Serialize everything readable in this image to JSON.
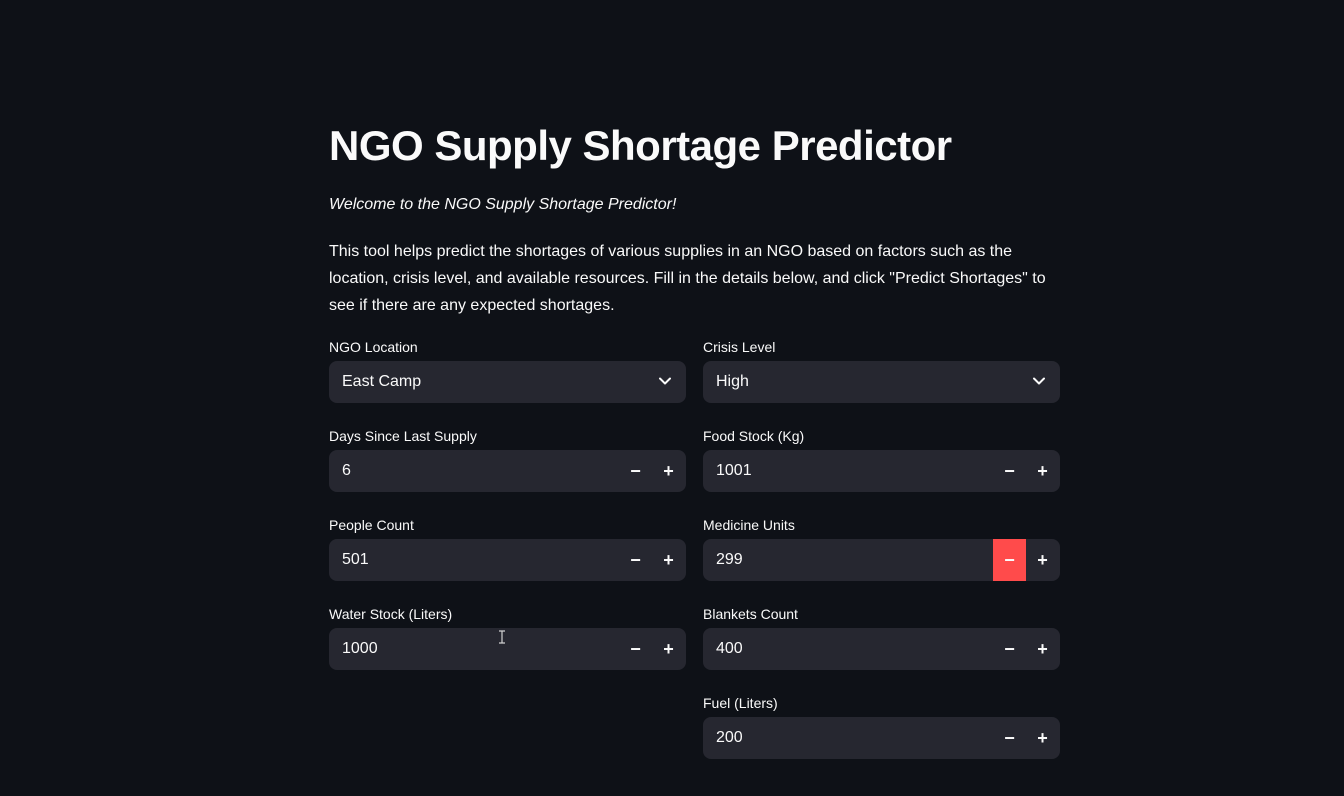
{
  "page": {
    "title": "NGO Supply Shortage Predictor",
    "welcome": "Welcome to the NGO Supply Shortage Predictor!",
    "description": "This tool helps predict the shortages of various supplies in an NGO based on factors such as the location, crisis level, and available resources. Fill in the details below, and click \"Predict Shortages\" to see if there are any expected shortages."
  },
  "form": {
    "location": {
      "label": "NGO Location",
      "value": "East Camp"
    },
    "crisis_level": {
      "label": "Crisis Level",
      "value": "High"
    },
    "days_since_supply": {
      "label": "Days Since Last Supply",
      "value": "6"
    },
    "food_stock": {
      "label": "Food Stock (Kg)",
      "value": "1001"
    },
    "people_count": {
      "label": "People Count",
      "value": "501"
    },
    "medicine_units": {
      "label": "Medicine Units",
      "value": "299"
    },
    "water_stock": {
      "label": "Water Stock (Liters)",
      "value": "1000"
    },
    "blankets_count": {
      "label": "Blankets Count",
      "value": "400"
    },
    "fuel": {
      "label": "Fuel (Liters)",
      "value": "200"
    },
    "minus_symbol": "−",
    "plus_symbol": "+"
  },
  "colors": {
    "background": "#0e1117",
    "input_bg": "#262730",
    "accent": "#ff4b4b",
    "text": "#fafafa"
  },
  "icons": {
    "dropdown": "chevron-down-icon",
    "cursor": "text-cursor-icon"
  }
}
